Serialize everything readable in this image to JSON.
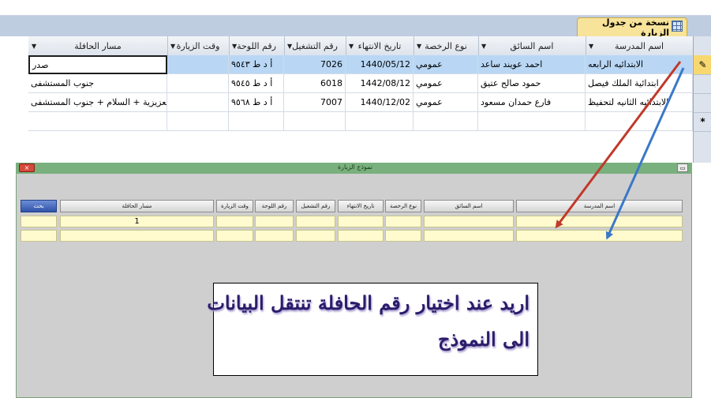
{
  "table_window": {
    "tab_title": "نسخة من جدول الزيارة",
    "columns": [
      {
        "label": "اسم المدرسة"
      },
      {
        "label": "اسم السائق"
      },
      {
        "label": "نوع الرخصة"
      },
      {
        "label": "تاريخ الانتهاء"
      },
      {
        "label": "رقم التشغيل"
      },
      {
        "label": "رقم اللوحة"
      },
      {
        "label": "وقت الزيارة"
      },
      {
        "label": "مسار الحافلة"
      }
    ],
    "rows": [
      {
        "school": "الابتدائيه الرابعه",
        "driver": "احمد عويند ساعد",
        "license": "عمومي",
        "expiry": "1440/05/12",
        "op_no": "7026",
        "plate": "أ د ط ٩٥٤٣",
        "visit_time": "",
        "route": "صدر"
      },
      {
        "school": "ابتدائية الملك فيصل",
        "driver": "حمود صالح عتيق",
        "license": "عمومي",
        "expiry": "1442/08/12",
        "op_no": "6018",
        "plate": "أ د ط ٩٥٤٥",
        "visit_time": "",
        "route": "جنوب المستشفى"
      },
      {
        "school": "الابتدائيه الثانيه لتحفيظ",
        "driver": "فارع حمدان مسعود",
        "license": "عمومي",
        "expiry": "1440/12/02",
        "op_no": "7007",
        "plate": "أ د ط ٩٥٦٨",
        "visit_time": "",
        "route": "العزيزية + السلام + جنوب المستشفى"
      }
    ],
    "new_row_marker": "*",
    "current_row_marker": "✎"
  },
  "form_window": {
    "title": "نموذج الزيارة",
    "close_label": "×",
    "restore_label": "▭",
    "fields": [
      {
        "label": "اسم المدرسة"
      },
      {
        "label": "اسم السائق"
      },
      {
        "label": "نوع الرخصة"
      },
      {
        "label": "تاريخ الانتهاء"
      },
      {
        "label": "رقم التشغيل"
      },
      {
        "label": "رقم اللوحة"
      },
      {
        "label": "وقت الزيارة"
      },
      {
        "label": "مسار الحافلة"
      }
    ],
    "search_button_label": "بحث",
    "route_value": "1"
  },
  "annotation": {
    "line1": "اريد عند اختيار رقم الحافلة تنتقل البيانات",
    "line2": "الى النموذج"
  },
  "colors": {
    "arrow_red": "#c0392b",
    "arrow_blue": "#3a78c8",
    "tab_bg": "#f7e39a",
    "selected_row": "#b9d7f5",
    "form_field": "#fffbcf",
    "form_titlebar": "#79b07e"
  }
}
